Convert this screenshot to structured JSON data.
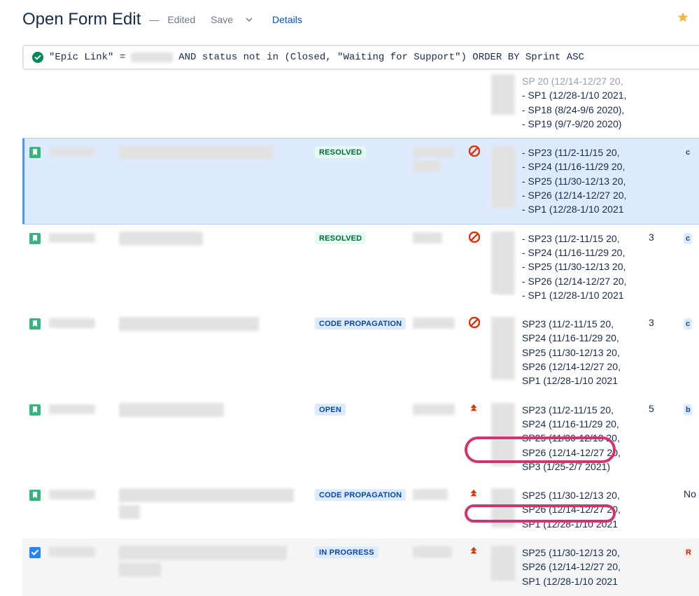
{
  "header": {
    "title": "Open Form Edit",
    "status": "Edited",
    "save_label": "Save",
    "details_label": "Details"
  },
  "query": {
    "prefix": "\"Epic Link\" = ",
    "suffix": " AND status not in (Closed, \"Waiting for Support\") ORDER BY Sprint ASC"
  },
  "statuses": {
    "resolved": "RESOLVED",
    "code_prop": "CODE PROPAGATION",
    "open": "OPEN",
    "in_progress": "IN PROGRESS"
  },
  "points": {
    "r2": "3",
    "r3": "3",
    "r4": "5"
  },
  "end_label_no": "No",
  "partial_sprints": [
    "- SP1 (12/28-1/10 2021,",
    "- SP18 (8/24-9/6 2020),",
    "- SP19 (9/7-9/20 2020)"
  ],
  "partial_sprints_cut": "  SP 20 (12/14-12/27 20,",
  "row1_sprints": [
    "- SP23 (11/2-11/15 20,",
    "- SP24 (11/16-11/29 20,",
    "- SP25 (11/30-12/13 20,",
    "- SP26 (12/14-12/27 20,",
    "- SP1 (12/28-1/10 2021"
  ],
  "row2_sprints": [
    "- SP23 (11/2-11/15 20,",
    "- SP24 (11/16-11/29 20,",
    "- SP25 (11/30-12/13 20,",
    "- SP26 (12/14-12/27 20,",
    "- SP1 (12/28-1/10 2021"
  ],
  "row3_sprints": [
    "SP23 (11/2-11/15 20,",
    "SP24 (11/16-11/29 20,",
    "SP25 (11/30-12/13 20,",
    "SP26 (12/14-12/27 20,",
    "SP1 (12/28-1/10 2021"
  ],
  "row4_sprints": [
    "SP23 (11/2-11/15 20,",
    "SP24 (11/16-11/29 20,",
    "SP25 (11/30-12/13 20,",
    "SP26 (12/14-12/27 20,",
    "SP3 (1/25-2/7 2021)"
  ],
  "row5_sprints": [
    "SP25 (11/30-12/13 20,",
    "SP26 (12/14-12/27 20,",
    "SP1 (12/28-1/10 2021"
  ],
  "row6_sprints": [
    "SP25 (11/30-12/13 20,",
    "SP26 (12/14-12/27 20,",
    "SP1 (12/28-1/10 2021"
  ]
}
